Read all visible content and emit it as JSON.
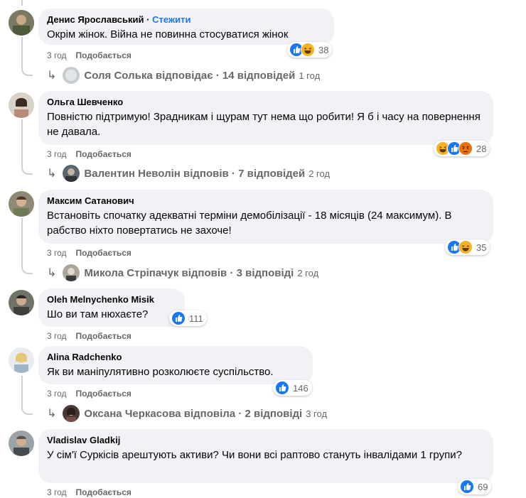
{
  "comments": [
    {
      "author": "Денис Ярославський",
      "follow": "Стежити",
      "text": "Окрім жінок. Війна не повинна стосуватися жінок",
      "time": "3 год",
      "like": "Подобається",
      "reactions": [
        "like",
        "haha"
      ],
      "count": "38",
      "reply": {
        "text": "Соля Солька відповідає · 14 відповідей",
        "time": "1 год"
      }
    },
    {
      "author": "Ольга Шевченко",
      "text": "Повністю підтримую! Зрадникам і щурам тут нема що робити! Я б і часу на повернення не давала.",
      "time": "3 год",
      "like": "Подобається",
      "reactions": [
        "haha",
        "like",
        "angry"
      ],
      "count": "28",
      "reply": {
        "text": "Валентин Неволін відповів · 7 відповідей",
        "time": "2 год"
      }
    },
    {
      "author": "Максим Сатанович",
      "text": "Встановіть спочатку адекватні терміни демобілізації - 18 місяців (24 максимум). В рабство ніхто повертатись не захоче!",
      "time": "3 год",
      "like": "Подобається",
      "reactions": [
        "like",
        "haha"
      ],
      "count": "35",
      "reply": {
        "text": "Микола Стріпачук відповів · 3 відповіді",
        "time": "2 год"
      }
    },
    {
      "author": "Oleh Melnychenko Misik",
      "text": "Шо ви там нюхаєте?",
      "time": "3 год",
      "like": "Подобається",
      "reactions": [
        "like"
      ],
      "count": "111"
    },
    {
      "author": "Alina Radchenko",
      "text": "Як ви маніпулятивно розколюєте суспільство.",
      "time": "3 год",
      "like": "Подобається",
      "reactions": [
        "like"
      ],
      "count": "146",
      "reply": {
        "text": "Оксана Черкасова відповіла · 2 відповіді",
        "time": "3 год"
      }
    },
    {
      "author": "Vladislav Gladkij",
      "text": "У сім'ї Суркісів арештують активи? Чи вони всі раптово стануть інвалідами 1 групи?",
      "time": "3 год",
      "like": "Подобається",
      "reactions": [
        "like"
      ],
      "count": "69"
    }
  ],
  "colors": {
    "bubble": "#f0f2f5",
    "like": "#1877f2",
    "haha": "#f7b125",
    "angry": "#e9710f",
    "meta": "#65676b",
    "follow": "#1877f2"
  }
}
